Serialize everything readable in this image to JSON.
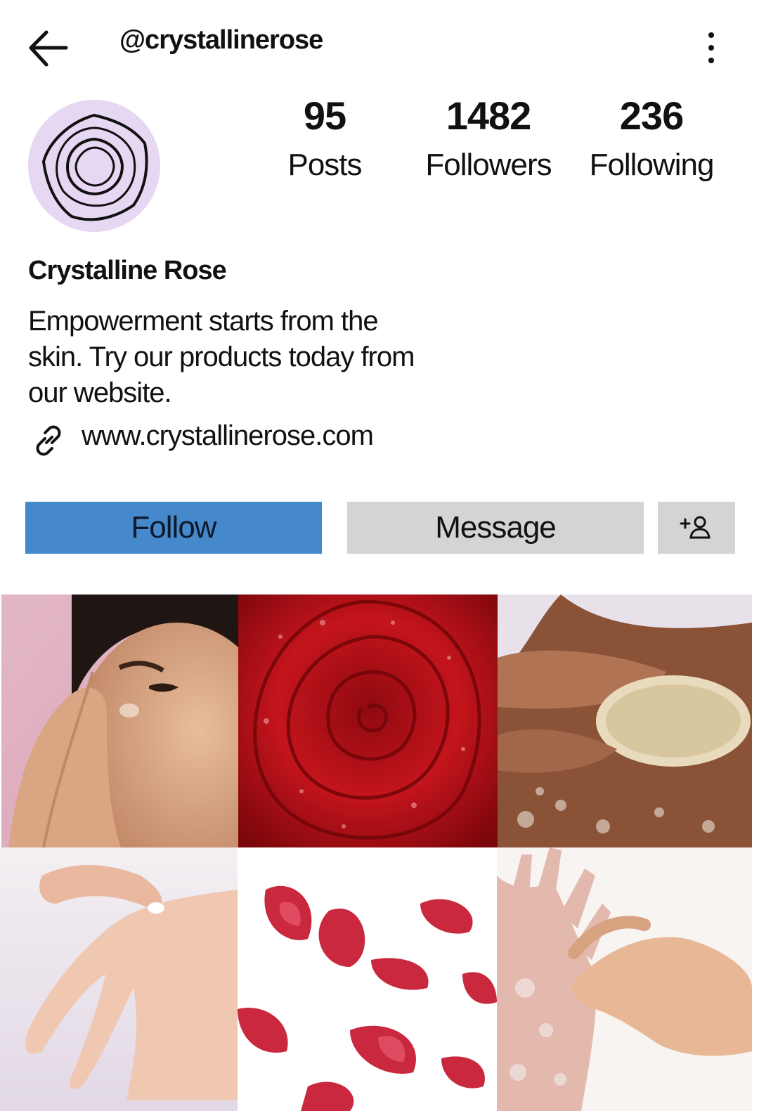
{
  "header": {
    "handle": "@crystallinerose",
    "back_icon": "back-arrow-icon",
    "more_icon": "more-vertical-icon"
  },
  "profile": {
    "avatar_icon": "rose-logo-icon",
    "avatar_bg": "#e6d7f3",
    "stats": [
      {
        "value": "95",
        "label": "Posts"
      },
      {
        "value": "1482",
        "label": "Followers"
      },
      {
        "value": "236",
        "label": "Following"
      }
    ],
    "display_name": "Crystalline Rose",
    "bio_lines": [
      "Empowerment starts from the",
      "skin. Try our products today from",
      "our website."
    ],
    "link_icon": "link-icon",
    "link": "www.crystallinerose.com"
  },
  "actions": {
    "follow_label": "Follow",
    "message_label": "Message",
    "add_icon": "add-person-icon",
    "follow_color": "#4589cc",
    "secondary_color": "#d3d4d5"
  },
  "grid": {
    "posts": [
      {
        "subject": "face-skincare"
      },
      {
        "subject": "red-rose"
      },
      {
        "subject": "loofah-scrub"
      },
      {
        "subject": "hand-cream"
      },
      {
        "subject": "rose-petals"
      },
      {
        "subject": "hand-exfoliation"
      }
    ]
  }
}
